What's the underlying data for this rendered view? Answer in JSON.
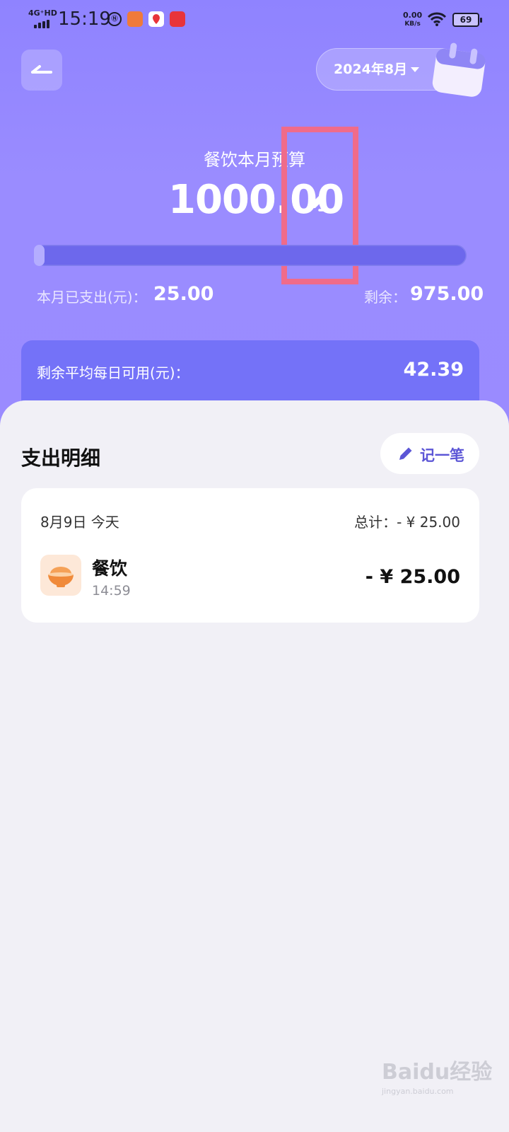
{
  "status_bar": {
    "network": "4G⁺HD",
    "time": "15:19",
    "net_speed_value": "0.00",
    "net_speed_unit": "KB/s",
    "battery": "69"
  },
  "header": {
    "month_selector": "2024年8月"
  },
  "budget": {
    "label": "餐饮本月预算",
    "amount": "1000.00",
    "progress_fraction": 0.025,
    "spent_label": "本月已支出(元)：",
    "spent_value": "25.00",
    "remaining_label": "剩余：",
    "remaining_value": "975.00"
  },
  "daily": {
    "label": "剩余平均每日可用(元)：",
    "value": "42.39"
  },
  "details": {
    "title": "支出明细",
    "record_button": "记一笔",
    "groups": [
      {
        "date": "8月9日 今天",
        "total": "总计：- ¥ 25.00",
        "items": [
          {
            "category": "餐饮",
            "time": "14:59",
            "amount": "- ¥ 25.00",
            "icon": "rice-bowl-icon"
          }
        ]
      }
    ]
  },
  "watermark": {
    "main": "Baidu经验",
    "sub": "jingyan.baidu.com"
  },
  "colors": {
    "hero": "#9487ff",
    "accent": "#5c56d6",
    "highlight": "#f06b8a"
  }
}
